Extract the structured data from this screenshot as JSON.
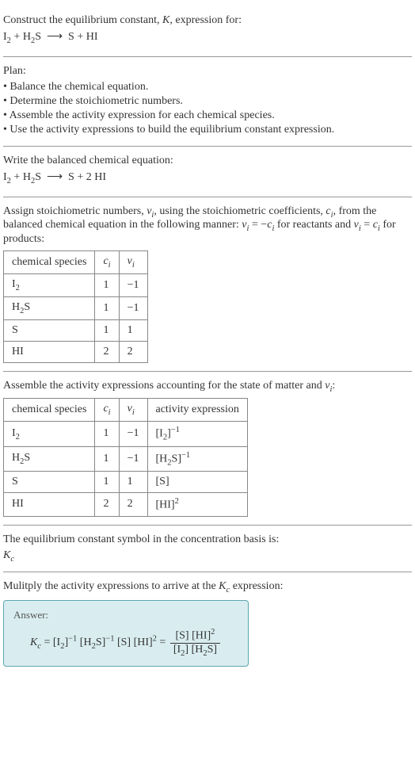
{
  "prompt": {
    "line1_prefix": "Construct the equilibrium constant, ",
    "line1_k": "K",
    "line1_suffix": ", expression for:",
    "equation_unbalanced_html": "I<sub>2</sub> + H<sub>2</sub>S &nbsp;⟶&nbsp; S + HI"
  },
  "plan": {
    "heading": "Plan:",
    "items": [
      "Balance the chemical equation.",
      "Determine the stoichiometric numbers.",
      "Assemble the activity expression for each chemical species.",
      "Use the activity expressions to build the equilibrium constant expression."
    ]
  },
  "balanced": {
    "heading": "Write the balanced chemical equation:",
    "equation_html": "I<sub>2</sub> + H<sub>2</sub>S &nbsp;⟶&nbsp; S + 2 HI"
  },
  "stoich": {
    "intro_html": "Assign stoichiometric numbers, <span class=\"italic\">ν<sub>i</sub></span>, using the stoichiometric coefficients, <span class=\"italic\">c<sub>i</sub></span>, from the balanced chemical equation in the following manner: <span class=\"italic\">ν<sub>i</sub></span> = −<span class=\"italic\">c<sub>i</sub></span> for reactants and <span class=\"italic\">ν<sub>i</sub></span> = <span class=\"italic\">c<sub>i</sub></span> for products:",
    "headers": [
      "chemical species",
      "c_i",
      "ν_i"
    ],
    "headers_html": [
      "chemical species",
      "<span class=\"italic\">c<sub>i</sub></span>",
      "<span class=\"italic\">ν<sub>i</sub></span>"
    ],
    "rows": [
      {
        "species_html": "I<sub>2</sub>",
        "c": "1",
        "nu": "−1"
      },
      {
        "species_html": "H<sub>2</sub>S",
        "c": "1",
        "nu": "−1"
      },
      {
        "species_html": "S",
        "c": "1",
        "nu": "1"
      },
      {
        "species_html": "HI",
        "c": "2",
        "nu": "2"
      }
    ]
  },
  "activity": {
    "intro_html": "Assemble the activity expressions accounting for the state of matter and <span class=\"italic\">ν<sub>i</sub></span>:",
    "headers_html": [
      "chemical species",
      "<span class=\"italic\">c<sub>i</sub></span>",
      "<span class=\"italic\">ν<sub>i</sub></span>",
      "activity expression"
    ],
    "rows": [
      {
        "species_html": "I<sub>2</sub>",
        "c": "1",
        "nu": "−1",
        "act_html": "[I<sub>2</sub>]<sup>−1</sup>"
      },
      {
        "species_html": "H<sub>2</sub>S",
        "c": "1",
        "nu": "−1",
        "act_html": "[H<sub>2</sub>S]<sup>−1</sup>"
      },
      {
        "species_html": "S",
        "c": "1",
        "nu": "1",
        "act_html": "[S]"
      },
      {
        "species_html": "HI",
        "c": "2",
        "nu": "2",
        "act_html": "[HI]<sup>2</sup>"
      }
    ]
  },
  "symbol": {
    "intro": "The equilibrium constant symbol in the concentration basis is:",
    "kc_html": "<span class=\"italic\">K<sub>c</sub></span>"
  },
  "multiply": {
    "intro_html": "Mulitply the activity expressions to arrive at the <span class=\"italic\">K<sub>c</sub></span> expression:"
  },
  "answer": {
    "label": "Answer:",
    "lhs_html": "<span class=\"italic\">K<sub>c</sub></span> = [I<sub>2</sub>]<sup>−1</sup> [H<sub>2</sub>S]<sup>−1</sup> [S] [HI]<sup>2</sup> = ",
    "frac_num_html": "[S] [HI]<sup>2</sup>",
    "frac_den_html": "[I<sub>2</sub>] [H<sub>2</sub>S]"
  }
}
